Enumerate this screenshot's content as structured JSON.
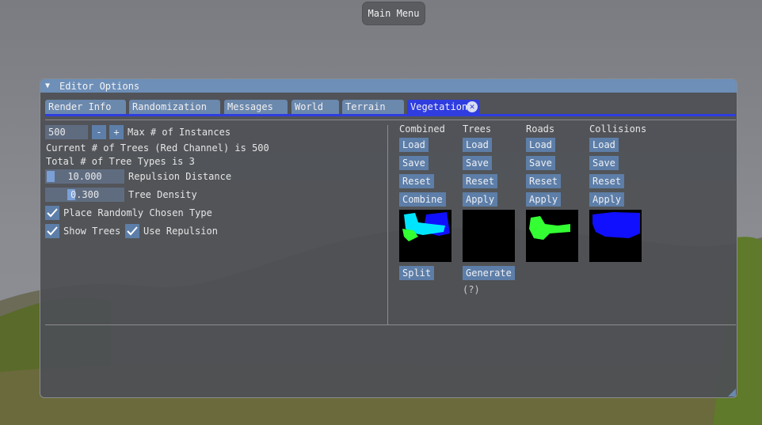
{
  "main_menu": {
    "label": "Main Menu"
  },
  "window": {
    "title": "Editor Options",
    "tabs": [
      {
        "label": "Render Info",
        "active": false
      },
      {
        "label": "Randomization",
        "active": false
      },
      {
        "label": "Messages",
        "active": false
      },
      {
        "label": "World",
        "active": false
      },
      {
        "label": "Terrain",
        "active": false
      },
      {
        "label": "Vegetation",
        "active": true
      }
    ]
  },
  "left": {
    "instances_value": "500",
    "minus_label": "-",
    "plus_label": "+",
    "max_instances_label": "Max # of Instances",
    "current_trees_text": "Current # of Trees (Red Channel) is 500",
    "total_types_text": "Total # of Tree Types is 3",
    "repulsion_value": "10.000",
    "repulsion_label": "Repulsion Distance",
    "repulsion_fraction": 0.0,
    "density_value": "0.300",
    "density_label": "Tree Density",
    "density_fraction": 0.3,
    "place_random_label": "Place Randomly Chosen Type",
    "place_random_checked": true,
    "show_trees_label": "Show Trees",
    "show_trees_checked": true,
    "use_repulsion_label": "Use Repulsion",
    "use_repulsion_checked": true
  },
  "right": {
    "columns": [
      {
        "header": "Combined",
        "buttons": [
          "Load",
          "Save",
          "Reset",
          "Combine"
        ],
        "bottom_button": "Split"
      },
      {
        "header": "Trees",
        "buttons": [
          "Load",
          "Save",
          "Reset",
          "Apply"
        ],
        "bottom_button": "Generate",
        "help": "(?)"
      },
      {
        "header": "Roads",
        "buttons": [
          "Load",
          "Save",
          "Reset",
          "Apply"
        ]
      },
      {
        "header": "Collisions",
        "buttons": [
          "Load",
          "Save",
          "Reset",
          "Apply"
        ]
      }
    ]
  },
  "colors": {
    "title_bar": "#6d8fb8",
    "tab": "#6b88ad",
    "tab_active": "#2f3de0",
    "button": "#5d7ea8",
    "check": "#ffffff"
  },
  "icons": {
    "collapse": "triangle-down-icon",
    "tab_close": "close-circle-icon",
    "check": "checkmark-icon",
    "resize": "resize-grip-icon"
  }
}
